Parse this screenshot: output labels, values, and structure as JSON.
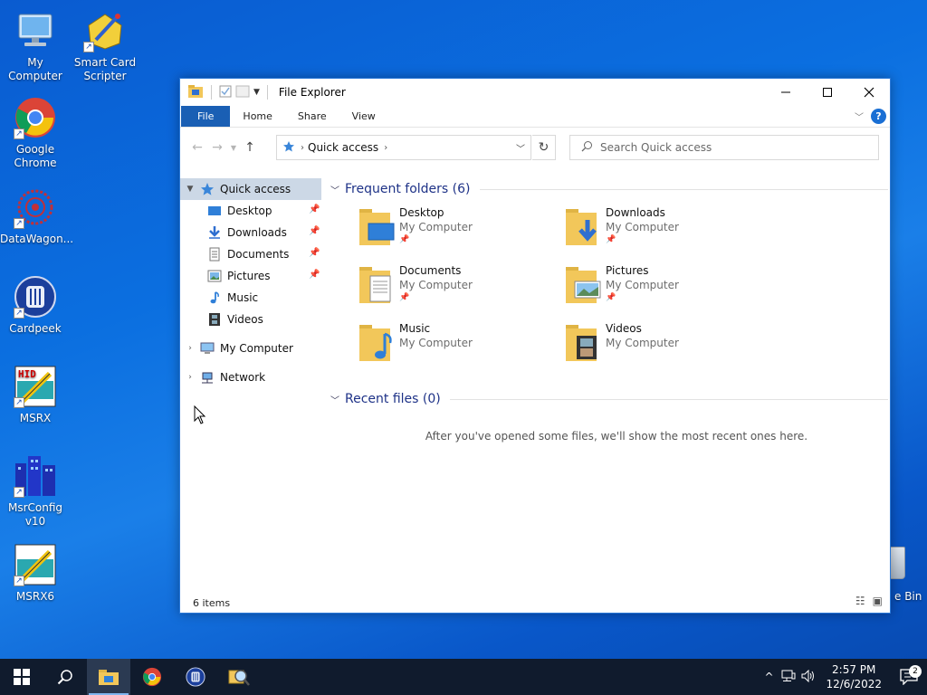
{
  "desktop": {
    "icons": [
      {
        "label": "My Computer"
      },
      {
        "label": "Smart Card Scripter"
      },
      {
        "label": "Google Chrome"
      },
      {
        "label": "DataWagon..."
      },
      {
        "label": "Cardpeek"
      },
      {
        "label": "MSRX"
      },
      {
        "label": "MsrConfig v10"
      },
      {
        "label": "MSRX6"
      }
    ],
    "recycle_bin_partial": "e Bin"
  },
  "window": {
    "title": "File Explorer",
    "ribbon_tabs": [
      "File",
      "Home",
      "Share",
      "View"
    ],
    "address": {
      "location": "Quick access"
    },
    "search": {
      "placeholder": "Search Quick access"
    },
    "nav": {
      "quick_access": "Quick access",
      "pinned": [
        {
          "label": "Desktop",
          "pinned": true
        },
        {
          "label": "Downloads",
          "pinned": true
        },
        {
          "label": "Documents",
          "pinned": true
        },
        {
          "label": "Pictures",
          "pinned": true
        },
        {
          "label": "Music",
          "pinned": false
        },
        {
          "label": "Videos",
          "pinned": false
        }
      ],
      "my_computer": "My Computer",
      "network": "Network"
    },
    "frequent": {
      "header": "Frequent folders (6)",
      "folders": [
        {
          "name": "Desktop",
          "location": "My Computer",
          "pinned": true
        },
        {
          "name": "Downloads",
          "location": "My Computer",
          "pinned": true
        },
        {
          "name": "Documents",
          "location": "My Computer",
          "pinned": true
        },
        {
          "name": "Pictures",
          "location": "My Computer",
          "pinned": true
        },
        {
          "name": "Music",
          "location": "My Computer",
          "pinned": false
        },
        {
          "name": "Videos",
          "location": "My Computer",
          "pinned": false
        }
      ]
    },
    "recent": {
      "header": "Recent files (0)",
      "empty_message": "After you've opened some files, we'll show the most recent ones here."
    },
    "status": {
      "items": "6 items"
    }
  },
  "taskbar": {
    "clock": {
      "time": "2:57 PM",
      "date": "12/6/2022"
    },
    "notification_count": "2"
  },
  "colors": {
    "accent": "#1a5fb4",
    "folder": "#f2c75a",
    "taskbar": "#101b2d"
  }
}
